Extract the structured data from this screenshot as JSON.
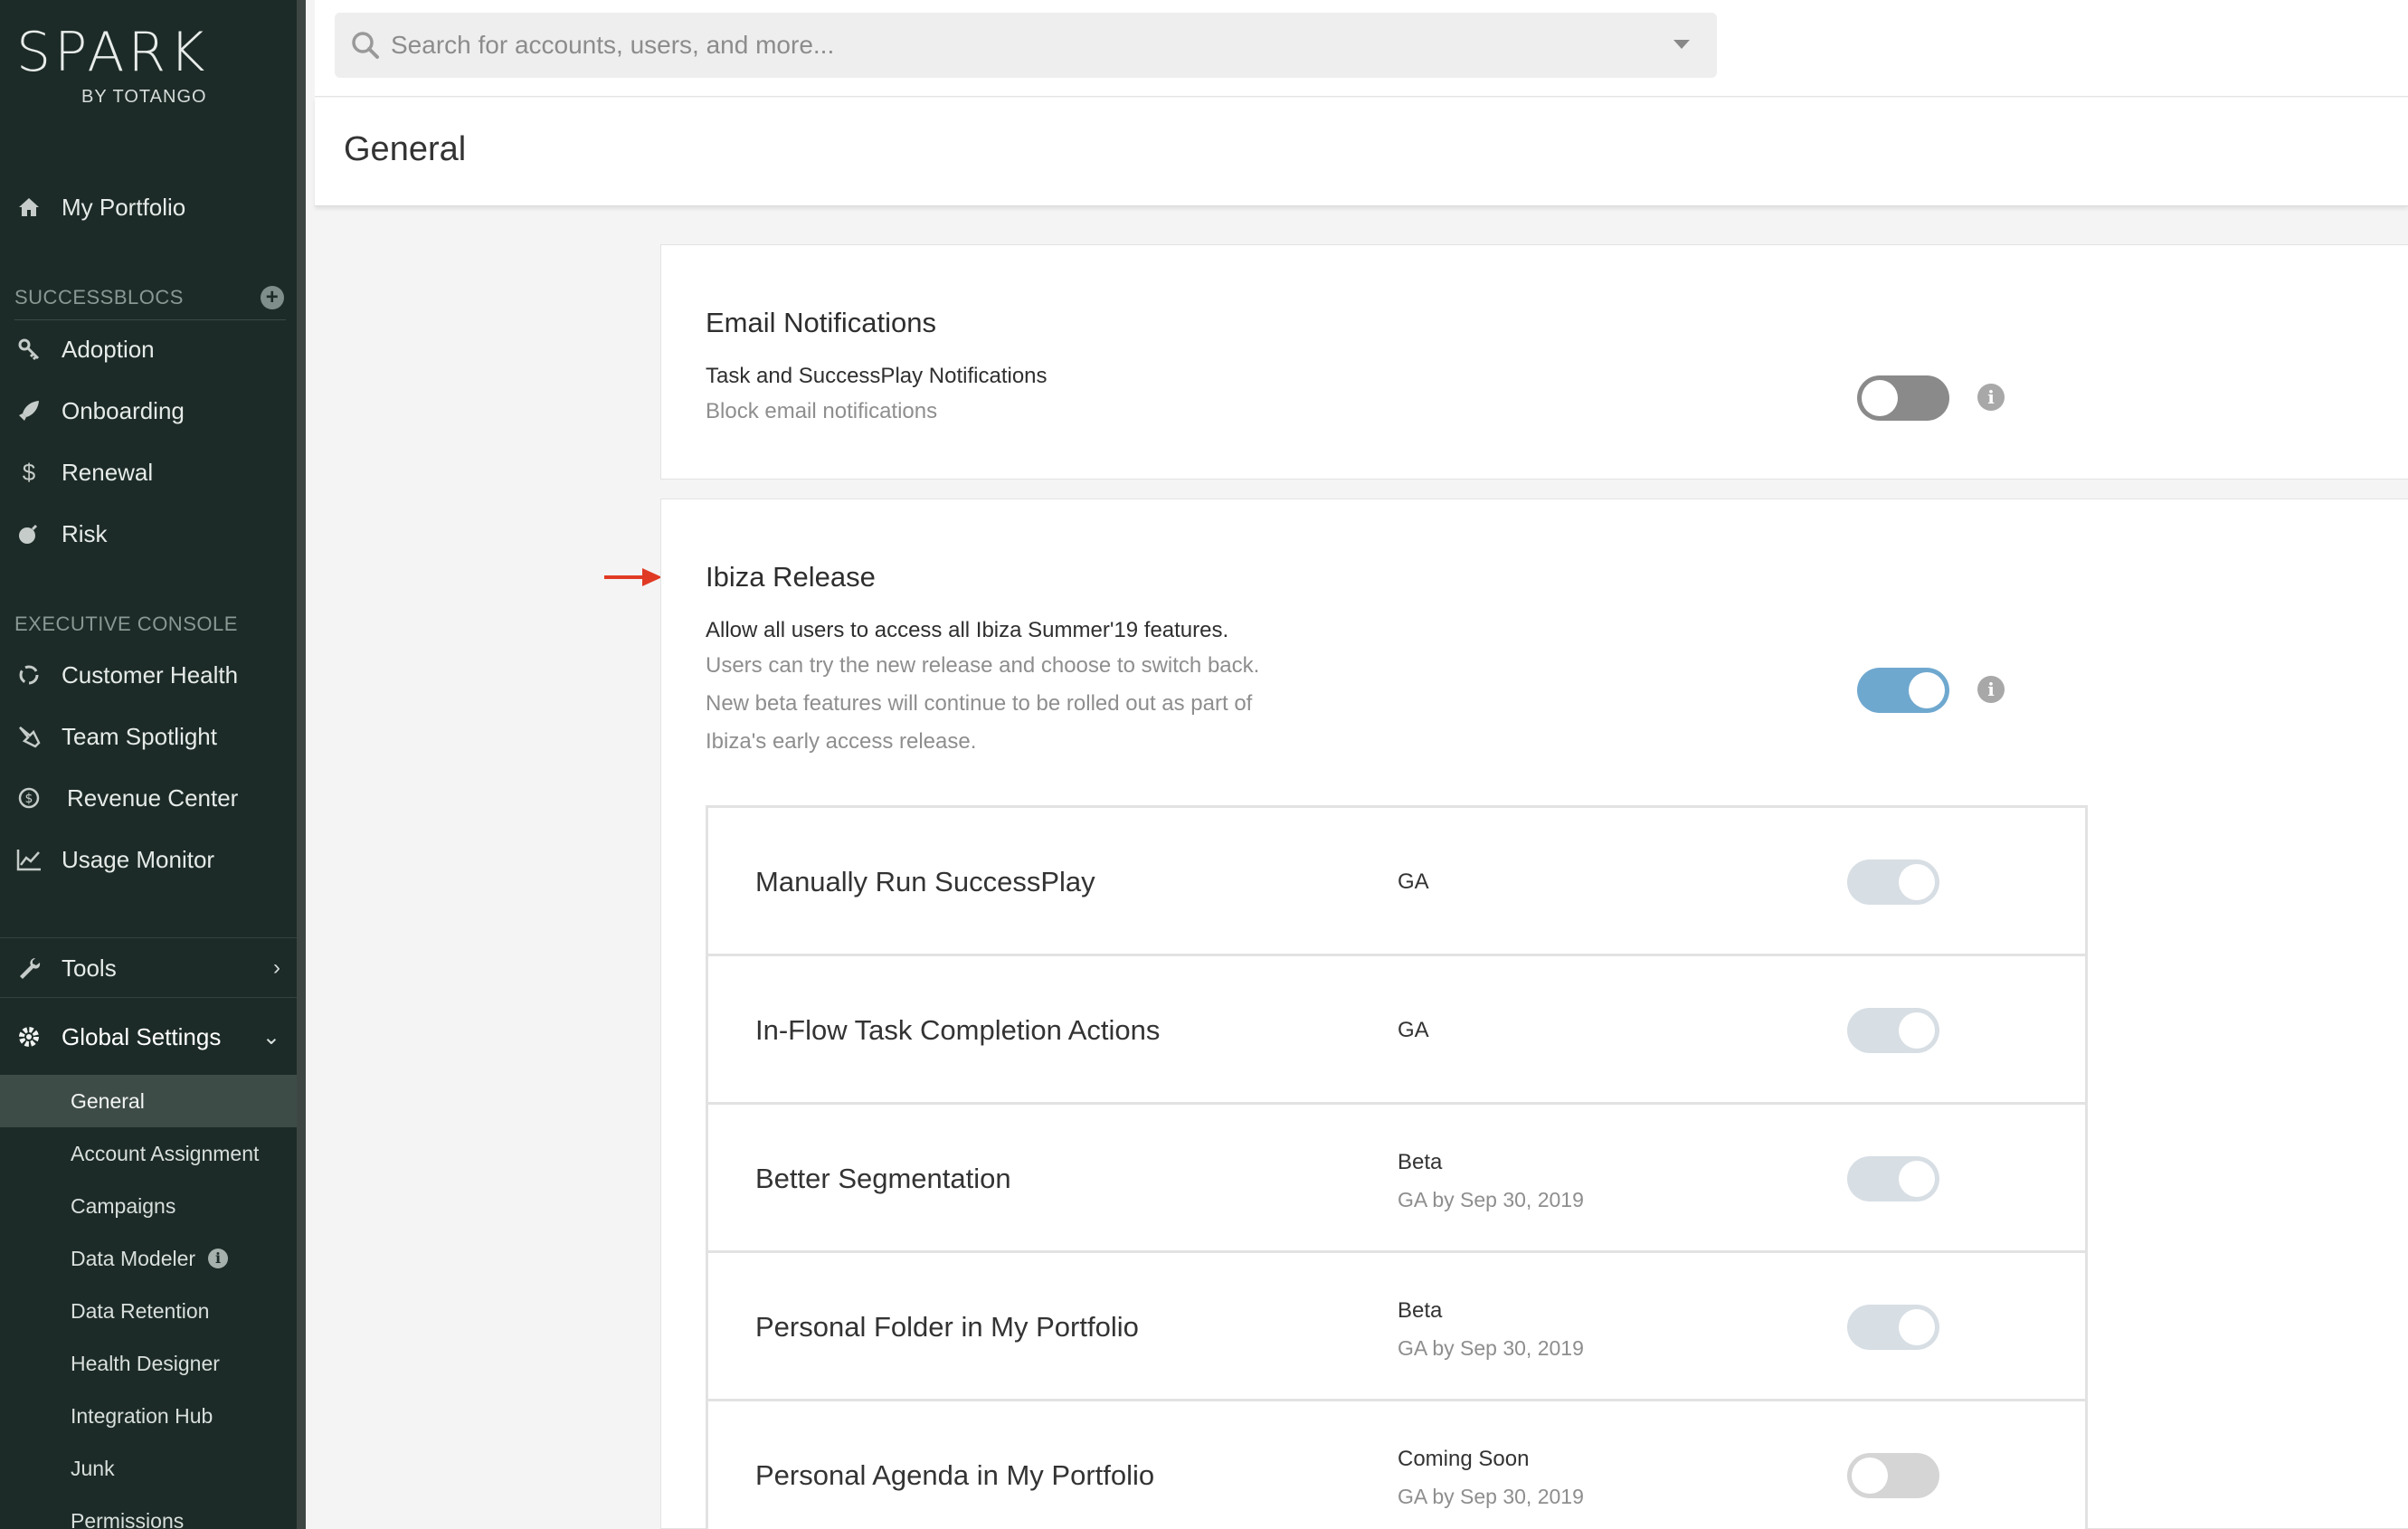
{
  "brand": {
    "logo_text": "SPARK",
    "logo_sub": "BY TOTANGO"
  },
  "sidebar": {
    "portfolio": "My Portfolio",
    "successblocs_heading": "SUCCESSBLOCS",
    "successblocs": [
      {
        "label": "Adoption",
        "icon": "key-icon"
      },
      {
        "label": "Onboarding",
        "icon": "rocket-icon"
      },
      {
        "label": "Renewal",
        "icon": "dollar-icon"
      },
      {
        "label": "Risk",
        "icon": "bomb-icon"
      }
    ],
    "exec_heading": "EXECUTIVE CONSOLE",
    "exec_items": [
      {
        "label": "Customer Health",
        "icon": "health-cycle-icon"
      },
      {
        "label": "Team Spotlight",
        "icon": "spotlight-icon"
      },
      {
        "label": "Revenue Center",
        "icon": "coin-icon"
      },
      {
        "label": "Usage Monitor",
        "icon": "line-chart-icon"
      }
    ],
    "tools": "Tools",
    "global_settings": "Global Settings",
    "settings_items": [
      "General",
      "Account Assignment",
      "Campaigns",
      "Data Modeler",
      "Data Retention",
      "Health Designer",
      "Integration Hub",
      "Junk",
      "Permissions"
    ],
    "active_item": "General"
  },
  "search": {
    "placeholder": "Search for accounts, users, and more..."
  },
  "page": {
    "title": "General"
  },
  "email_card": {
    "title": "Email Notifications",
    "desc": "Task and SuccessPlay Notifications",
    "sub": "Block email notifications",
    "toggle_on": false
  },
  "ibiza_card": {
    "title": "Ibiza Release",
    "desc": "Allow all users to access all Ibiza Summer'19 features.",
    "sub1": "Users can try the new release and choose to switch back.",
    "sub2": "New beta features will continue to be rolled out as part of",
    "sub3": "Ibiza's early access release.",
    "toggle_on": true
  },
  "features": [
    {
      "name": "Manually Run SuccessPlay",
      "status": "GA",
      "ga": "",
      "on": true
    },
    {
      "name": "In-Flow Task Completion Actions",
      "status": "GA",
      "ga": "",
      "on": true
    },
    {
      "name": "Better Segmentation",
      "status": "Beta",
      "ga": "GA by Sep 30, 2019",
      "on": true
    },
    {
      "name": "Personal Folder in My Portfolio",
      "status": "Beta",
      "ga": "GA by Sep 30, 2019",
      "on": true
    },
    {
      "name": "Personal Agenda in My Portfolio",
      "status": "Coming Soon",
      "ga": "GA by Sep 30, 2019",
      "on": false
    }
  ],
  "colors": {
    "sidebar_bg": "#1c2b27",
    "toggle_on": "#6fa8cf",
    "arrow": "#e03a24"
  }
}
